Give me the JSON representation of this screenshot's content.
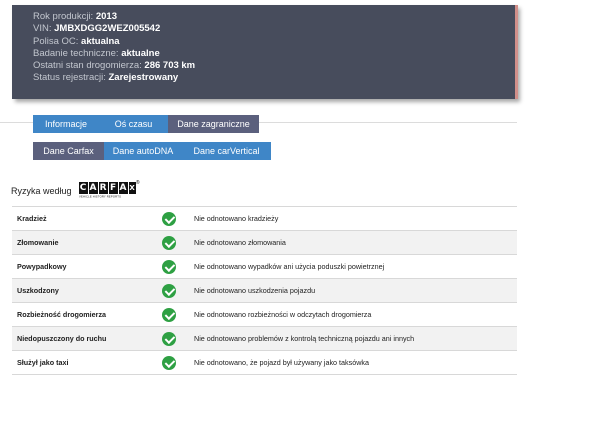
{
  "vehicle": {
    "rows": [
      {
        "label": "Rok produkcji: ",
        "value": "2013"
      },
      {
        "label": "VIN: ",
        "value": "JMBXDGG2WEZ005542"
      },
      {
        "label": "Polisa OC: ",
        "value": "aktualna"
      },
      {
        "label": "Badanie techniczne: ",
        "value": "aktualne"
      },
      {
        "label": "Ostatni stan drogomierza: ",
        "value": "286 703 km"
      },
      {
        "label": "Status rejestracji: ",
        "value": "Zarejestrowany"
      }
    ]
  },
  "tabs_main": [
    {
      "label": "Informacje",
      "active": false
    },
    {
      "label": "Oś czasu",
      "active": false
    },
    {
      "label": "Dane zagraniczne",
      "active": true
    }
  ],
  "tabs_sub": [
    {
      "label": "Dane Carfax",
      "active": true
    },
    {
      "label": "Dane autoDNA",
      "active": false
    },
    {
      "label": "Dane carVertical",
      "active": false
    }
  ],
  "risk": {
    "heading": "Ryzyka według",
    "logo_text": "CARFAX",
    "logo_tagline": "VEHICLE HISTORY REPORTS",
    "logo_reg": "®",
    "status_icon": "check-circle",
    "status_color": "#2ea043",
    "rows": [
      {
        "label": "Kradzież",
        "desc": "Nie odnotowano kradzieży"
      },
      {
        "label": "Złomowanie",
        "desc": "Nie odnotowano złomowania"
      },
      {
        "label": "Powypadkowy",
        "desc": "Nie odnotowano wypadków ani użycia poduszki powietrznej"
      },
      {
        "label": "Uszkodzony",
        "desc": "Nie odnotowano uszkodzenia pojazdu"
      },
      {
        "label": "Rozbieżność drogomierza",
        "desc": "Nie odnotowano rozbieżności w odczytach drogomierza"
      },
      {
        "label": "Niedopuszczony do ruchu",
        "desc": "Nie odnotowano problemów z kontrolą techniczną pojazdu ani innych"
      },
      {
        "label": "Służył jako taxi",
        "desc": "Nie odnotowano, że pojazd był używany jako taksówka"
      }
    ]
  }
}
